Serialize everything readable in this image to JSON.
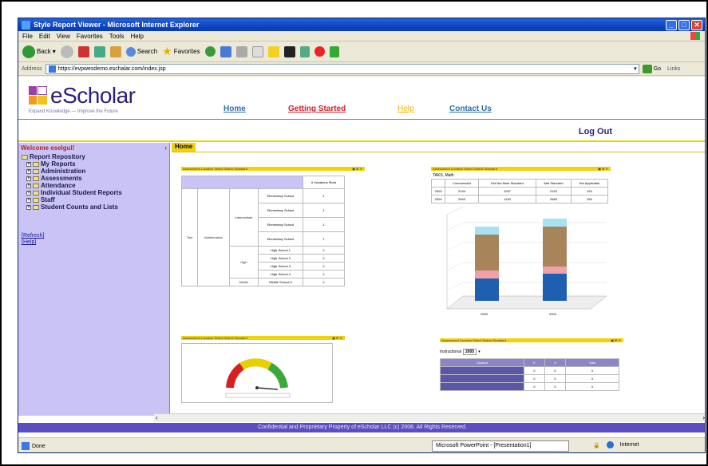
{
  "window": {
    "title": "Style Report Viewer - Microsoft Internet Explorer"
  },
  "menu": [
    "File",
    "Edit",
    "View",
    "Favorites",
    "Tools",
    "Help"
  ],
  "toolbar": {
    "back": "Back",
    "search": "Search",
    "favorites": "Favorites"
  },
  "address": {
    "label": "Address",
    "url": "https://evpwesdemo.eschalar.com/index.jsp",
    "go": "Go",
    "links": "Links"
  },
  "brand": {
    "name": "eScholar",
    "tagline": "Expand Knowledge — Improve the Future"
  },
  "nav": [
    {
      "label": "Home",
      "color": "#2a6fb0"
    },
    {
      "label": "Getting Started",
      "color": "#d0202a"
    },
    {
      "label": "Help",
      "color": "#f0b400"
    },
    {
      "label": "Contact Us",
      "color": "#2a6fb0"
    }
  ],
  "logout": "Log Out",
  "sidebar": {
    "welcome": "Welcome eselgul!",
    "items": [
      "Report Repository",
      "My Reports",
      "Administration",
      "Assessments",
      "Attendance",
      "Individual Student Reports",
      "Staff",
      "Student Counts and Lists"
    ],
    "refresh": "[Refresh]",
    "help": "[Help]"
  },
  "tab": "Home",
  "panel1": {
    "header": "Assessment Location Select District Standard",
    "col": "# Vocations Stdnt"
  },
  "panel2": {
    "header": "Assessment Location Select District Standard",
    "subtitle": "TAKS, Math",
    "headers": [
      "Commended",
      "Did Not Meet Standard",
      "Met Standard",
      "Not Applicable"
    ],
    "rows": [
      {
        "year": "2003",
        "vals": [
          "2134",
          "1057",
          "2152",
          "193"
        ]
      },
      {
        "year": "2004",
        "vals": [
          "2540",
          "1130",
          "2680",
          "155"
        ]
      }
    ],
    "xticks": [
      "2003",
      "2004"
    ]
  },
  "panel3": {
    "header": "Assessment Location Select District Standard"
  },
  "panel4": {
    "header": "Assessment Location Select District Standard",
    "select_label": "Instructional",
    "select_value": "2005",
    "cols": [
      "Student",
      "E",
      "S",
      "Total"
    ]
  },
  "footer": "Confidential and Proprietary Property of eScholar LLC (c) 2006. All Rights Reserved.",
  "status": {
    "done": "Done",
    "task": "Microsoft PowerPoint - [Presentation1]",
    "zone": "Internet"
  }
}
